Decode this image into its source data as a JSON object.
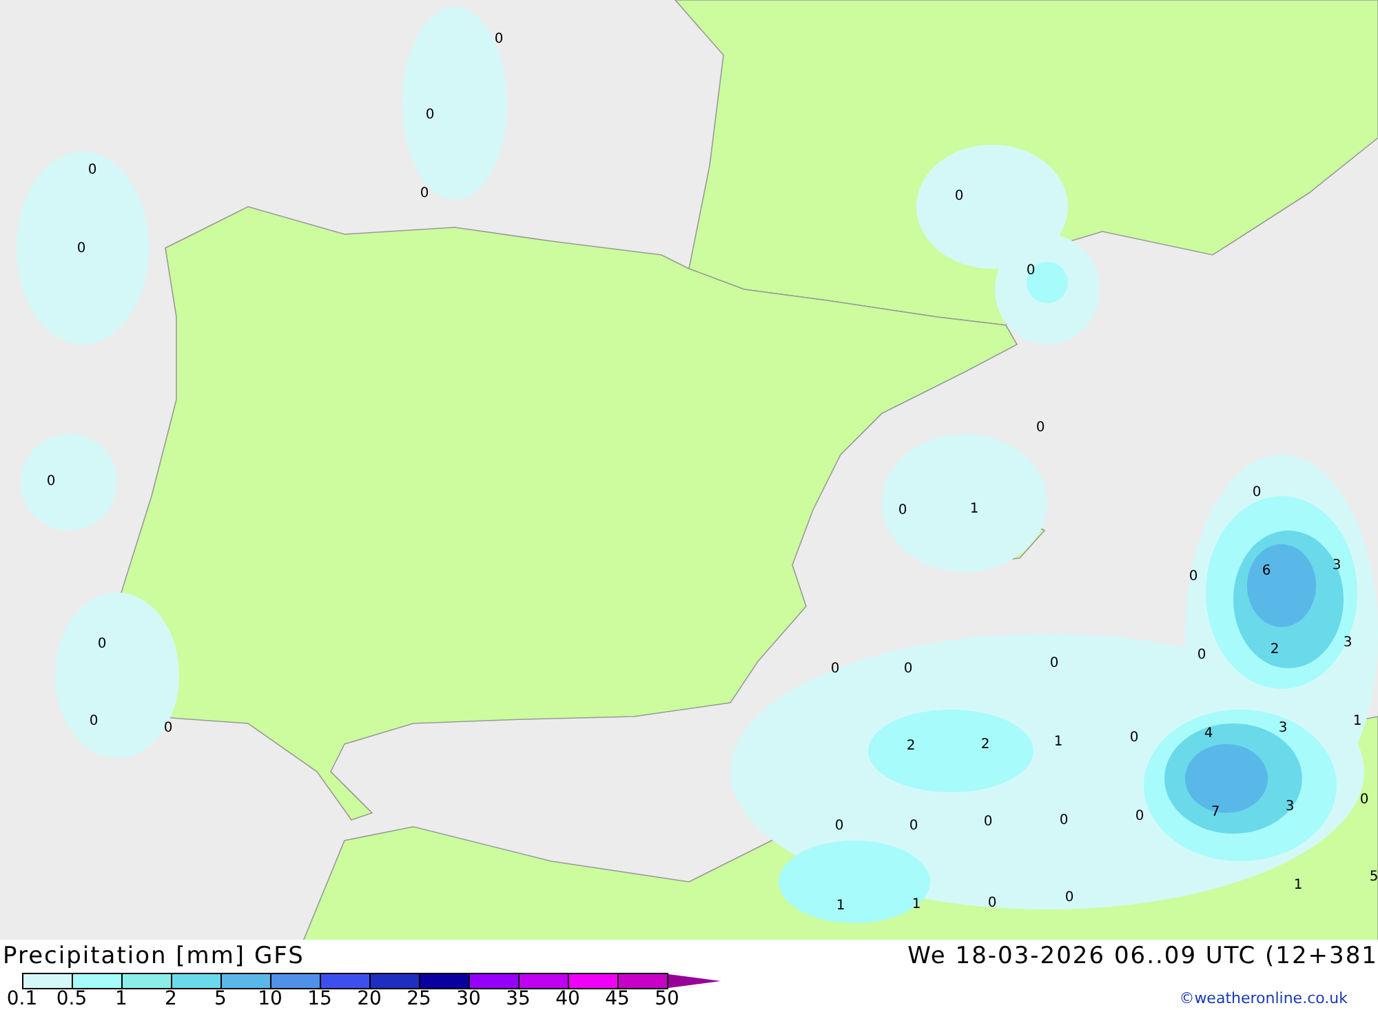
{
  "map": {
    "labels": [
      "0",
      "0",
      "0",
      "0",
      "0",
      "0",
      "0",
      "0",
      "0",
      "0",
      "0",
      "1",
      "6",
      "3",
      "0",
      "3",
      "2",
      "0",
      "0",
      "0",
      "0",
      "0",
      "0",
      "0",
      "2",
      "2",
      "1",
      "0",
      "4",
      "3",
      "1",
      "7",
      "3",
      "0",
      "0",
      "0",
      "0",
      "0",
      "0",
      "1",
      "5",
      "1",
      "1",
      "0",
      "0"
    ]
  },
  "header": {
    "title": "Precipitation [mm] GFS",
    "datetime": "We 18-03-2026 06..09 UTC (12+381"
  },
  "legend": {
    "bins": [
      {
        "color": "#d4f8f8"
      },
      {
        "color": "#a8fbfb"
      },
      {
        "color": "#8aefe8"
      },
      {
        "color": "#6ad9ea"
      },
      {
        "color": "#5ab8e8"
      },
      {
        "color": "#5090e8"
      },
      {
        "color": "#3c50f0"
      },
      {
        "color": "#1e2ec0"
      },
      {
        "color": "#0a00a0"
      },
      {
        "color": "#9600fa"
      },
      {
        "color": "#c000f0"
      },
      {
        "color": "#f000f8"
      },
      {
        "color": "#c800c8"
      },
      {
        "color": "#960096",
        "kind": "arrow"
      }
    ],
    "ticks": [
      "0.1",
      "0.5",
      "1",
      "2",
      "5",
      "10",
      "15",
      "20",
      "25",
      "30",
      "35",
      "40",
      "45",
      "50"
    ]
  },
  "credit": "©weatheronline.co.uk"
}
